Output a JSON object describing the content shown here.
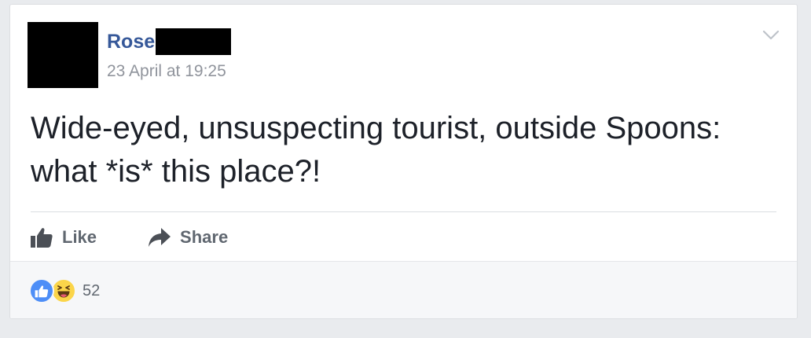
{
  "post": {
    "author_name": "Rose",
    "timestamp": "23 April at 19:25",
    "text": "Wide-eyed, unsuspecting tourist, outside Spoons: what *is* this place?!"
  },
  "actions": {
    "like_label": "Like",
    "share_label": "Share"
  },
  "reactions": {
    "count": "52",
    "types": [
      "like-icon",
      "haha-icon"
    ]
  },
  "icons": {
    "options": "chevron-down-icon",
    "like": "thumbs-up-icon",
    "share": "share-arrow-icon"
  },
  "colors": {
    "author_link": "#365899",
    "timestamp": "#90949c",
    "body_text": "#1d2129",
    "action_text": "#606770",
    "like_reaction": "#4d8ef7",
    "haha_reaction": "#fbd54a",
    "page_background": "#e9ebee"
  }
}
